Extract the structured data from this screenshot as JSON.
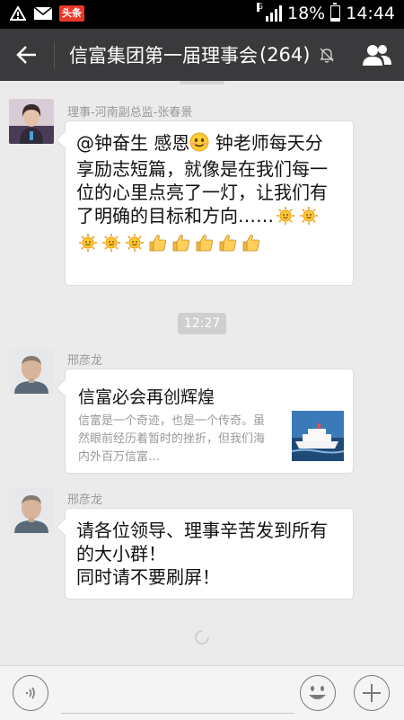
{
  "status_bar": {
    "network_type": "G",
    "battery": "18%",
    "battery_level": 0.18,
    "time": "14:44",
    "news_app": "头条"
  },
  "header": {
    "title": "信富集团第一届理事会",
    "member_count": "(264)",
    "icons": [
      "back-arrow-icon",
      "mute-icon",
      "members-icon"
    ],
    "bg_color": "#3a3a3c"
  },
  "messages": [
    {
      "sender": "理事-河南副总监-张春景",
      "text_before_emoji": "@钟奋生 感恩",
      "text_after_emoji": " 钟老师每天分享励志短篇，就像是在我们每一位的心里点亮了一灯，让我们有了明确的目标和方向……",
      "emojis": [
        "smile",
        "sun",
        "sun",
        "sun",
        "sun",
        "sun",
        "thumbs-up",
        "thumbs-up",
        "thumbs-up",
        "thumbs-up",
        "thumbs-up"
      ]
    },
    {
      "type": "timestamp",
      "text": "12:27"
    },
    {
      "sender": "邢彦龙",
      "link_title": "信富必会再创辉煌",
      "link_desc": "信富是一个奇迹，也是一个传奇。虽然眼前经历着暂时的挫折，但我们海内外百万信富…"
    },
    {
      "sender": "邢彦龙",
      "text": "请各位领导、理事辛苦发到所有的大小群！\n同时请不要刷屏！"
    }
  ],
  "input_bar": {
    "placeholder": "",
    "icons": [
      "voice-icon",
      "emoji-icon",
      "plus-icon"
    ]
  }
}
